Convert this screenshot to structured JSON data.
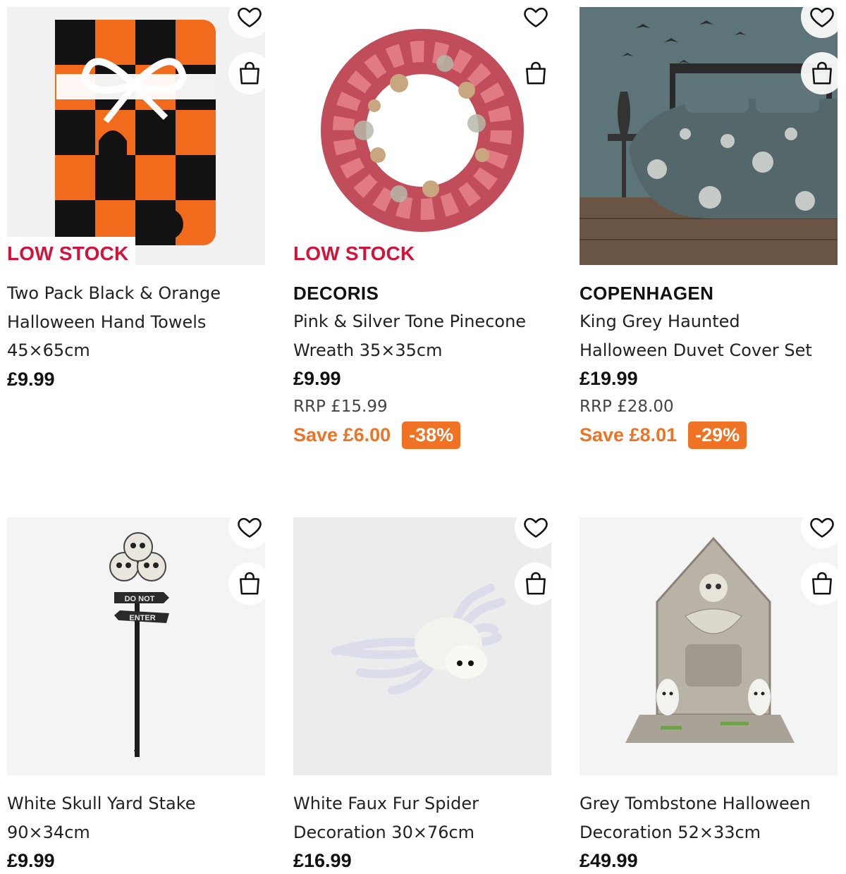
{
  "colors": {
    "accent": "#f07325",
    "low_stock": "#d4123a"
  },
  "products": [
    {
      "badge": "LOW STOCK",
      "brand": "",
      "title_line1": "Two Pack Black & Orange",
      "title_line2": "Halloween Hand Towels",
      "title_line3": "45×65cm",
      "price": "£9.99",
      "rrp": "",
      "save": "",
      "discount": ""
    },
    {
      "badge": "LOW STOCK",
      "brand": "DECORIS",
      "title_line1": "Pink & Silver Tone Pinecone",
      "title_line2": "Wreath 35×35cm",
      "title_line3": "",
      "price": "£9.99",
      "rrp": "RRP £15.99",
      "save": "Save £6.00",
      "discount": "-38%"
    },
    {
      "badge": "",
      "brand": "COPENHAGEN",
      "title_line1": "King Grey Haunted",
      "title_line2": "Halloween Duvet Cover Set",
      "title_line3": "",
      "price": "£19.99",
      "rrp": "RRP £28.00",
      "save": "Save £8.01",
      "discount": "-29%"
    },
    {
      "badge": "",
      "brand": "",
      "title_line1": "White Skull Yard Stake",
      "title_line2": "90×34cm",
      "title_line3": "",
      "price": "£9.99",
      "rrp": "",
      "save": "",
      "discount": ""
    },
    {
      "badge": "",
      "brand": "",
      "title_line1": "White Faux Fur Spider",
      "title_line2": "Decoration 30×76cm",
      "title_line3": "",
      "price": "£16.99",
      "rrp": "",
      "save": "",
      "discount": ""
    },
    {
      "badge": "",
      "brand": "",
      "title_line1": "Grey Tombstone Halloween",
      "title_line2": "Decoration 52×33cm",
      "title_line3": "",
      "price": "£49.99",
      "rrp": "",
      "save": "",
      "discount": ""
    }
  ],
  "image_text": {
    "sign_top": "DO NOT",
    "sign_bottom": "ENTER"
  },
  "icons": {
    "favourite": "heart-icon",
    "basket": "shopping-bag-icon"
  }
}
